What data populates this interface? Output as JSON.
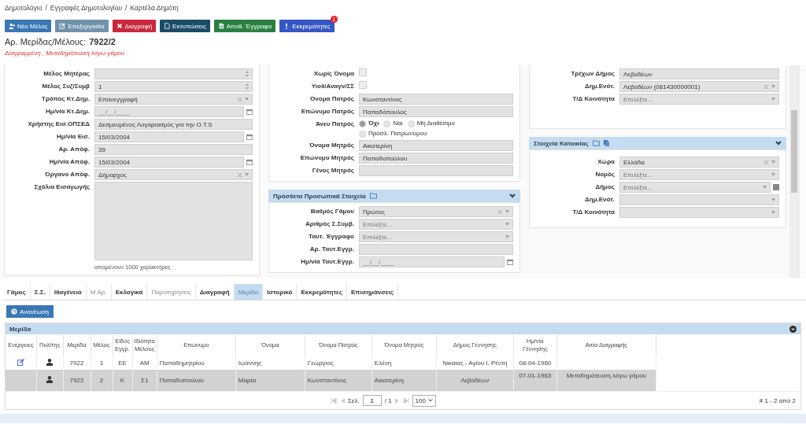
{
  "breadcrumb": {
    "separator": "/",
    "items": [
      "Δημοτολόγιο",
      "Εγγραφές Δημοτολογίου",
      "Καρτέλα Δημότη"
    ]
  },
  "toolbar": [
    {
      "label": "Νέο Μέλος",
      "color": "#3a78b5"
    },
    {
      "label": "Επεξεργασία",
      "color": "#6f93ab"
    },
    {
      "label": "Διαγραφή",
      "color": "#c9283e"
    },
    {
      "label": "Εκτυπώσεις",
      "color": "#1b4c68"
    },
    {
      "label": "Αποθ. Έγγραφα",
      "color": "#2a8042"
    },
    {
      "label": "Εκκρεμότητες",
      "color": "#3557c4",
      "badge": "1"
    }
  ],
  "record": {
    "label": "Αρ. Μερίδας/Μέλους:",
    "value": "7922/2",
    "status": "Διαγραμμένη , Μεταδημότευση λόγω γάμου"
  },
  "left_panel": {
    "fields": [
      {
        "label": "Μέλος Μητέρας",
        "kind": "spin"
      },
      {
        "label": "Μέλος Συζ/Συμβ",
        "kind": "spin",
        "value": "1"
      },
      {
        "label": "Τρόπος Κτ.Δημ.",
        "kind": "select",
        "value": "Επανεγγραφή"
      },
      {
        "label": "Ημ/νία Κτ.Δημ.",
        "kind": "date",
        "placeholder": "__/__/____"
      },
      {
        "label": "Χρήστης Εισ.ΟΠΣΕΔ",
        "kind": "text",
        "value": "Δεσμευμένος Λογαριασμός για την Ο.Τ.S"
      },
      {
        "label": "Ημ/νία Εισ.",
        "kind": "date",
        "value": "15/03/2004"
      },
      {
        "label": "Αρ. Απόφ.",
        "kind": "text",
        "value": "39"
      },
      {
        "label": "Ημ/νία Απόφ.",
        "kind": "date",
        "value": "15/03/2004"
      },
      {
        "label": "Όργανο Απόφ.",
        "kind": "select",
        "value": "Δήμαρχος"
      },
      {
        "label": "Σχόλια Εισαγωγής",
        "kind": "textarea",
        "counter": "απομένουν 1000 χαρακτήρες"
      }
    ]
  },
  "middle_panel": {
    "fields": [
      {
        "label": "Χωρίς Όνομα",
        "kind": "checkbox",
        "checked": false
      },
      {
        "label": "Υιοθ/Αναγν/ΣΣ",
        "kind": "checkbox",
        "checked": false
      },
      {
        "label": "Όνομα Πατρός",
        "kind": "text",
        "value": "Κωνσταντίνος"
      },
      {
        "label": "Επώνυμο Πατρός",
        "kind": "text",
        "value": "Παπαδόπουλος"
      },
      {
        "label": "Άνευ Πατρός",
        "kind": "radio",
        "options": [
          {
            "label": "Όχι",
            "selected": true
          },
          {
            "label": "Ναι",
            "selected": false
          },
          {
            "label": "Μη Διαθέσιμο",
            "selected": false
          },
          {
            "label": "Πρόσλ. Πατρωνύμου",
            "selected": false
          }
        ]
      },
      {
        "label": "Όνομα Μητρός",
        "kind": "text",
        "value": "Αικατερίνη"
      },
      {
        "label": "Επώνυμο Μητρός",
        "kind": "text",
        "value": "Παπαδοπούλου"
      },
      {
        "label": "Γένος Μητρός",
        "kind": "text"
      }
    ]
  },
  "additional_personal": {
    "title": "Πρόσθετα Προσωπικά Στοιχεία",
    "fields": [
      {
        "label": "Βαθμός Γάμου",
        "kind": "select",
        "value": "Πρώτος"
      },
      {
        "label": "Αριθμός Σ.Συμβ.",
        "kind": "select",
        "placeholder": "Επιλέξτε..."
      },
      {
        "label": "Ταυτ. Έγγραφο",
        "kind": "select",
        "placeholder": "Επιλέξτε..."
      },
      {
        "label": "Αρ. Ταυτ.Εγγρ.",
        "kind": "text"
      },
      {
        "label": "Ημ/νία Ταυτ.Εγγρ.",
        "kind": "date",
        "placeholder": "__/__/____"
      }
    ]
  },
  "right_panel": {
    "fields": [
      {
        "label": "Τρέχων Δήμος",
        "kind": "text",
        "value": "Λεβαδέων"
      },
      {
        "label": "Δημ.Ενότ.",
        "kind": "select",
        "value": "Λεβαδέων (081430000001)"
      },
      {
        "label": "Τ/Δ Κοινότητα",
        "kind": "select",
        "placeholder": "Επιλέξτε..."
      }
    ]
  },
  "residence": {
    "title": "Στοιχεία Κατοικίας",
    "fields": [
      {
        "label": "Χώρα",
        "kind": "select",
        "value": "Ελλάδα"
      },
      {
        "label": "Νομός",
        "kind": "select",
        "placeholder": "Επιλέξτε..."
      },
      {
        "label": "Δήμος",
        "kind": "select-button",
        "placeholder": "Επιλέξτε..."
      },
      {
        "label": "Δημ.Ενότ.",
        "kind": "select"
      },
      {
        "label": "Τ/Δ Κοινότητα",
        "kind": "select"
      }
    ]
  },
  "tabs": [
    {
      "label": "Γάμος",
      "selected": false,
      "disabled": false
    },
    {
      "label": "Σ.Σ.",
      "selected": false,
      "disabled": false
    },
    {
      "label": "Ιθαγένεια",
      "selected": false,
      "disabled": false
    },
    {
      "label": "Μ.Αρ.",
      "selected": false,
      "disabled": true
    },
    {
      "label": "Εκλογικά",
      "selected": false,
      "disabled": false
    },
    {
      "label": "Παρατηρήσεις",
      "selected": false,
      "disabled": true
    },
    {
      "label": "Διαγραφή",
      "selected": false,
      "disabled": false
    },
    {
      "label": "Μερίδα",
      "selected": true,
      "disabled": false
    },
    {
      "label": "Ιστορικό",
      "selected": false,
      "disabled": false
    },
    {
      "label": "Εκκρεμότητες",
      "selected": false,
      "disabled": false
    },
    {
      "label": "Επισημάνσεις",
      "selected": false,
      "disabled": false
    }
  ],
  "refresh_button": "Ανανέωση",
  "grid": {
    "title": "Μερίδα",
    "columns": [
      "Ενέργειες",
      "Πολ/της",
      "Μερίδα",
      "Μέλος",
      "Είδος Εγγρ.",
      "Ιδιότητα Μέλους",
      "Επώνυμο",
      "Όνομα",
      "Όνομα Πατρός",
      "Όνομα Μητρός",
      "Δήμος Γέννησης",
      "Ημ/νία Γέννησης",
      "Αιτία Διαγραφής"
    ],
    "rows": [
      {
        "selected": false,
        "editable": true,
        "cells": [
          "",
          "",
          "7922",
          "1",
          "ΕΕ",
          "ΑΜ",
          "Παπαδημητρίου",
          "Ιωάννης",
          "Γεώργιος",
          "Ελένη",
          "Νικαιας - Αγίου Ι. Ρέντη",
          "08-04-1960",
          ""
        ]
      },
      {
        "selected": true,
        "editable": false,
        "cells": [
          "",
          "",
          "7922",
          "2",
          "Κ",
          "Σ1",
          "Παπαδοπούλου",
          "Μαρία",
          "Κωνσταντίνος",
          "Αικατερίνη",
          "Λεβαδέων",
          "07-01-1963",
          "Μεταδημότευση λόγω γάμου"
        ]
      }
    ],
    "pager": {
      "page_label": "Σελ.",
      "page": "1",
      "of": "/ 1",
      "page_size": "100",
      "summary": "# 1 - 2 από 2"
    }
  }
}
